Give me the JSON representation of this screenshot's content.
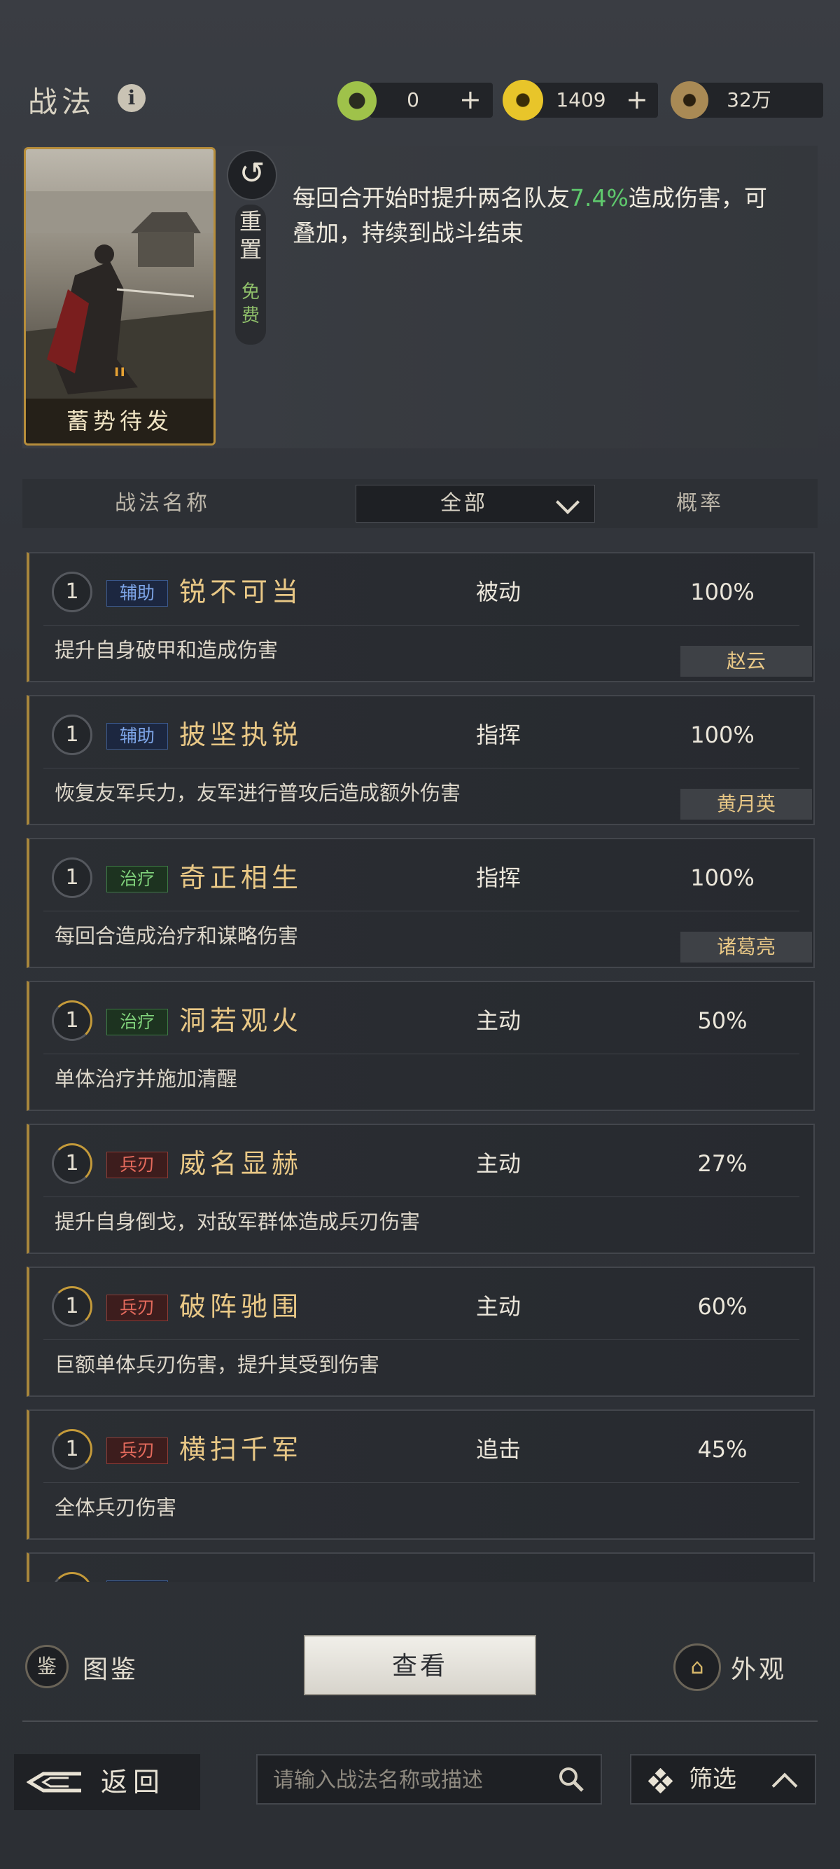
{
  "header": {
    "title": "战法",
    "info_icon": "info-icon",
    "resources": [
      {
        "icon": "jade-coin-icon",
        "value": "0",
        "plus": "+"
      },
      {
        "icon": "gold-coin-icon",
        "value": "1409",
        "plus": "+"
      },
      {
        "icon": "copper-coin-icon",
        "value": "32万"
      }
    ]
  },
  "selected_skill": {
    "card_name": "蓄势待发",
    "reset_label": "重置",
    "free_label": "免费",
    "description_prefix": "每回合开始时提升两名队友",
    "description_highlight": "7.4%",
    "description_suffix": "造成伤害，可叠加，持续到战斗结束",
    "highlight_color": "#5fc96d"
  },
  "list_header": {
    "name_col": "战法名称",
    "filter_value": "全部",
    "rate_col": "概率"
  },
  "tactics": [
    {
      "level": "1",
      "tag": "辅助",
      "tag_type": "fuzhu",
      "name": "锐不可当",
      "type": "被动",
      "rate": "100%",
      "desc": "提升自身破甲和造成伤害",
      "hero": "赵云"
    },
    {
      "level": "1",
      "tag": "辅助",
      "tag_type": "fuzhu",
      "name": "披坚执锐",
      "type": "指挥",
      "rate": "100%",
      "desc": "恢复友军兵力，友军进行普攻后造成额外伤害",
      "hero": "黄月英"
    },
    {
      "level": "1",
      "tag": "治疗",
      "tag_type": "zhiliao",
      "name": "奇正相生",
      "type": "指挥",
      "rate": "100%",
      "desc": "每回合造成治疗和谋略伤害",
      "hero": "诸葛亮"
    },
    {
      "level": "1",
      "tag": "治疗",
      "tag_type": "zhiliao",
      "name": "洞若观火",
      "type": "主动",
      "rate": "50%",
      "desc": "单体治疗并施加清醒",
      "hero": ""
    },
    {
      "level": "1",
      "tag": "兵刃",
      "tag_type": "bingren",
      "name": "威名显赫",
      "type": "主动",
      "rate": "27%",
      "desc": "提升自身倒戈，对敌军群体造成兵刃伤害",
      "hero": ""
    },
    {
      "level": "1",
      "tag": "兵刃",
      "tag_type": "bingren",
      "name": "破阵驰围",
      "type": "主动",
      "rate": "60%",
      "desc": "巨额单体兵刃伤害，提升其受到伤害",
      "hero": ""
    },
    {
      "level": "1",
      "tag": "兵刃",
      "tag_type": "bingren",
      "name": "横扫千军",
      "type": "追击",
      "rate": "45%",
      "desc": "全体兵刃伤害",
      "hero": ""
    }
  ],
  "actions": {
    "tujian_label": "图鉴",
    "view_label": "查看",
    "waiguan_label": "外观"
  },
  "footer": {
    "back_label": "返回",
    "search_placeholder": "请输入战法名称或描述",
    "filter_label": "筛选"
  }
}
